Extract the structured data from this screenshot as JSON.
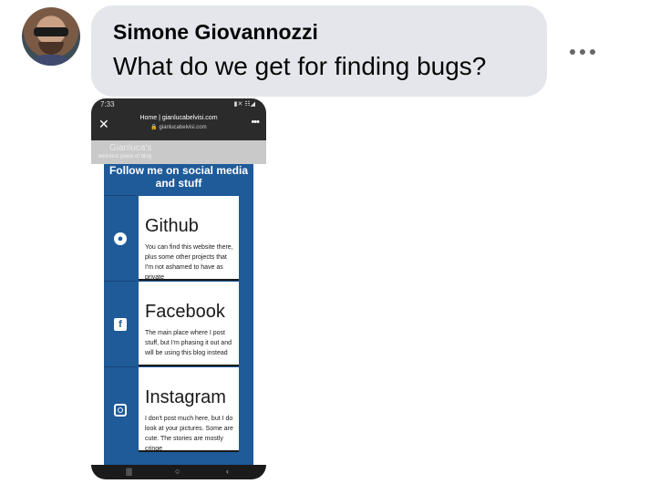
{
  "message": {
    "sender": "Simone Giovannozzi",
    "text": "What do we get for finding bugs?"
  },
  "phone": {
    "status_time": "7:33",
    "status_icons": "▮✕ ☷◢",
    "page_title": "Home | gianlucabelvisi.com",
    "page_url": "🔒 gianlucabelvisi.com",
    "site_brand": "Gianluca's",
    "site_tagline": "weirdest place of blog",
    "panel_title": "Follow me on social media and stuff",
    "cards": [
      {
        "title": "Github",
        "icon": "github-icon",
        "text": "You can find this website there, plus some other projects that I'm not ashamed to have as private"
      },
      {
        "title": "Facebook",
        "icon": "facebook-icon",
        "text": "The main place where I post stuff, but I'm phasing it out and will be using this blog instead"
      },
      {
        "title": "Instagram",
        "icon": "instagram-icon",
        "text": "I don't post much here, but I do look at your pictures. Some are cute. The stories are mostly cringe"
      }
    ],
    "nav": {
      "recent": "|||",
      "home": "○",
      "back": "‹"
    }
  }
}
